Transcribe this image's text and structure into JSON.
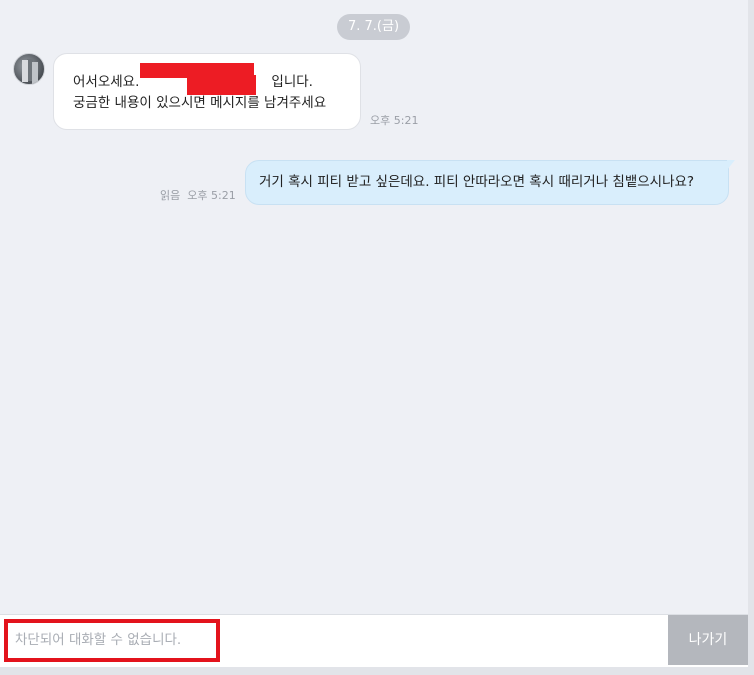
{
  "chat": {
    "date_label": "7. 7.(금)",
    "incoming": {
      "line1_prefix": "어서오세요.",
      "line1_suffix": "입니다.",
      "line2": "궁금한 내용이 있으시면 메시지를 남겨주세요",
      "time": "오후 5:21"
    },
    "outgoing": {
      "text": "거기 혹시 피티 받고 싶은데요. 피티 안따라오면 혹시 때리거나 침뱉으시나요?",
      "read_label": "읽음",
      "time": "오후 5:21"
    }
  },
  "footer": {
    "blocked_placeholder": "차단되어 대화할 수 없습니다.",
    "exit_label": "나가기"
  },
  "colors": {
    "incoming_bubble": "#ffffff",
    "outgoing_bubble": "#d9eefc",
    "redaction": "#ed1c24",
    "highlight_box": "#e3131c"
  }
}
